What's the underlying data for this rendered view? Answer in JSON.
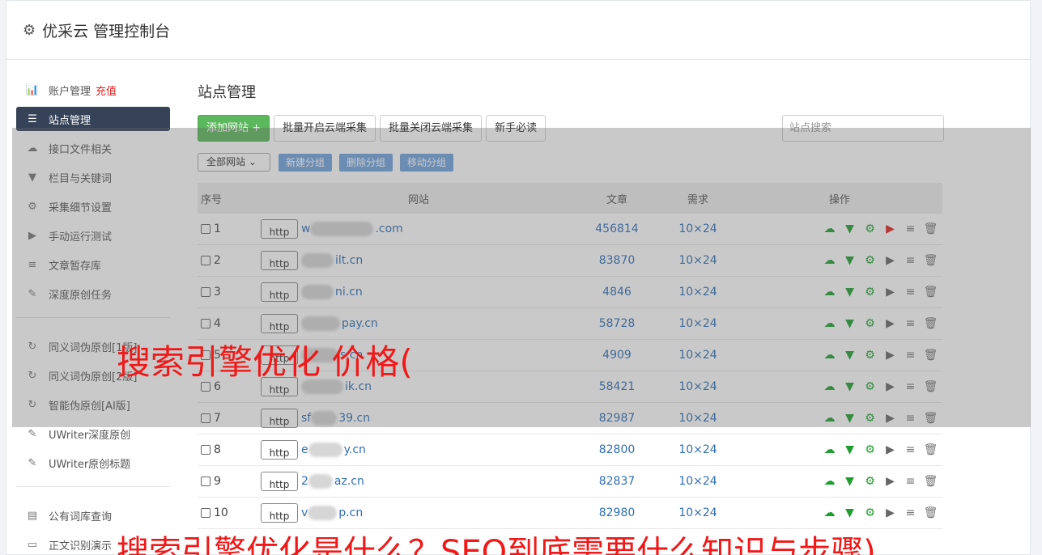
{
  "app": {
    "title": "优采云 管理控制台"
  },
  "sidebar": {
    "items": [
      {
        "icon": "bar-chart-icon",
        "glyph": "📊",
        "label": "账户管理",
        "extra": "充值"
      },
      {
        "icon": "server-icon",
        "glyph": "☰",
        "label": "站点管理",
        "active": true
      },
      {
        "icon": "cloud-upload-icon",
        "glyph": "☁",
        "label": "接口文件相关"
      },
      {
        "icon": "filter-icon",
        "glyph": "▼",
        "label": "栏目与关键词"
      },
      {
        "icon": "gears-icon",
        "glyph": "⚙",
        "label": "采集细节设置"
      },
      {
        "icon": "play-circle-icon",
        "glyph": "▶",
        "label": "手动运行测试"
      },
      {
        "icon": "database-icon",
        "glyph": "≡",
        "label": "文章暂存库"
      },
      {
        "icon": "edit-icon",
        "glyph": "✎",
        "label": "深度原创任务"
      }
    ],
    "group2": [
      {
        "icon": "refresh-icon",
        "glyph": "↻",
        "label": "同义词伪原创[1版]"
      },
      {
        "icon": "refresh-icon",
        "glyph": "↻",
        "label": "同义词伪原创[2版]"
      },
      {
        "icon": "refresh-icon",
        "glyph": "↻",
        "label": "智能伪原创[AI版]"
      },
      {
        "icon": "edit-icon",
        "glyph": "✎",
        "label": "UWriter深度原创"
      },
      {
        "icon": "edit-icon",
        "glyph": "✎",
        "label": "UWriter原创标题"
      }
    ],
    "group3": [
      {
        "icon": "book-icon",
        "glyph": "▤",
        "label": "公有词库查询"
      },
      {
        "icon": "monitor-icon",
        "glyph": "▭",
        "label": "正文识别演示"
      }
    ]
  },
  "main": {
    "title": "站点管理",
    "toolbar": {
      "add": "添加网站 +",
      "batch_open": "批量开启云端采集",
      "batch_close": "批量关闭云端采集",
      "newbie": "新手必读",
      "search_placeholder": "站点搜索"
    },
    "row2": {
      "select": "全部网站 ⌄",
      "new_group": "新建分组",
      "delete_group": "删除分组",
      "move_group": "移动分组"
    },
    "table": {
      "headers": {
        "no": "序号",
        "site": "网站",
        "articles": "文章",
        "demand": "需求",
        "ops": "操作"
      },
      "rows": [
        {
          "no": "1",
          "prefix": "w",
          "suffix": ".com",
          "articles": "456814",
          "demand": "10×24",
          "play_red": true
        },
        {
          "no": "2",
          "prefix": "",
          "suffix": "ilt.cn",
          "articles": "83870",
          "demand": "10×24"
        },
        {
          "no": "3",
          "prefix": "",
          "suffix": "ni.cn",
          "articles": "4846",
          "demand": "10×24"
        },
        {
          "no": "4",
          "prefix": "",
          "suffix": "pay.cn",
          "articles": "58728",
          "demand": "10×24"
        },
        {
          "no": "5",
          "prefix": "",
          "suffix": "s.cn",
          "articles": "4909",
          "demand": "10×24"
        },
        {
          "no": "6",
          "prefix": "",
          "suffix": "ik.cn",
          "articles": "58421",
          "demand": "10×24"
        },
        {
          "no": "7",
          "prefix": "sf",
          "suffix": "39.cn",
          "articles": "82987",
          "demand": "10×24"
        },
        {
          "no": "8",
          "prefix": "e",
          "suffix": "y.cn",
          "articles": "82800",
          "demand": "10×24"
        },
        {
          "no": "9",
          "prefix": "2",
          "suffix": "az.cn",
          "articles": "82837",
          "demand": "10×24"
        },
        {
          "no": "10",
          "prefix": "v",
          "suffix": "p.cn",
          "articles": "82980",
          "demand": "10×24"
        }
      ]
    }
  },
  "overlay": {
    "text1": "搜索引擎优化 价格(",
    "text2": "搜索引擎优化是什么？SEO到底需要什么知识与步骤)"
  },
  "http_label": "http",
  "colors": {
    "accent_blue": "#2f6eb5",
    "active_nav": "#354258",
    "green": "#5cb85c",
    "red": "#e02020"
  }
}
